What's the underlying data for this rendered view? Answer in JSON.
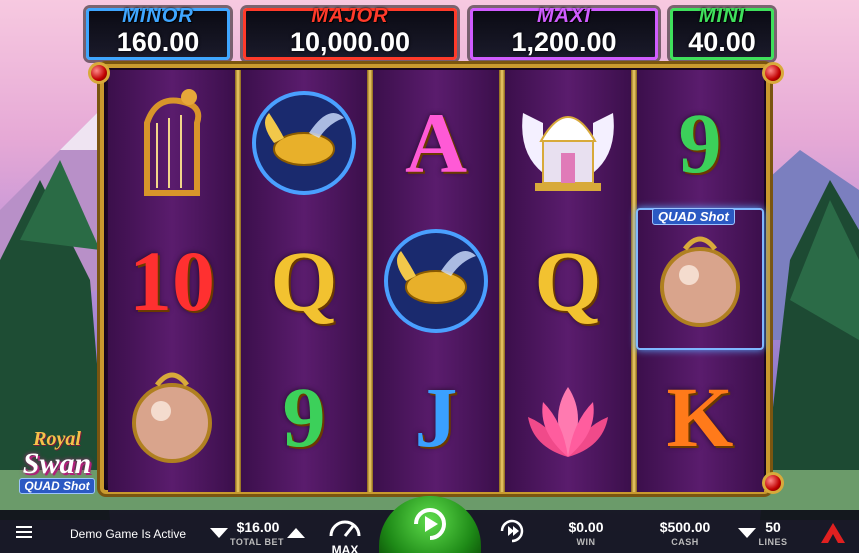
{
  "game": {
    "logo_lines": [
      "Royal",
      "Swan",
      "QUAD Shot"
    ]
  },
  "jackpots": [
    {
      "label": "MINOR",
      "value": "160.00",
      "label_color": "#3fa6ff",
      "border_color": "#3fa6ff"
    },
    {
      "label": "MAJOR",
      "value": "10,000.00",
      "label_color": "#ff3a2a",
      "border_color": "#ff3a2a"
    },
    {
      "label": "MAXI",
      "value": "1,200.00",
      "label_color": "#d05cff",
      "border_color": "#d05cff"
    },
    {
      "label": "MINI",
      "value": "40.00",
      "label_color": "#3fe05c",
      "border_color": "#3fe05c"
    }
  ],
  "reels": [
    [
      "swan-harp",
      "10",
      "pearl"
    ],
    [
      "koi-fish",
      "Q",
      "9"
    ],
    [
      "A",
      "koi-fish",
      "J"
    ],
    [
      "winged-temple",
      "Q",
      "lotus"
    ],
    [
      "9",
      "pearl",
      "K"
    ]
  ],
  "quad_shot_badge": "QUAD Shot",
  "bottom_bar": {
    "status": "Demo Game Is Active",
    "total_bet": "$16.00",
    "total_bet_label": "TOTAL BET",
    "max_label": "MAX",
    "win": "$0.00",
    "win_label": "WIN",
    "cash": "$500.00",
    "cash_label": "CASH",
    "lines": "50",
    "lines_label": "LINES"
  },
  "colors": {
    "reel_bg": "#4a1560",
    "frame_gold": "#c99a2e",
    "spin_green": "#2fb824"
  }
}
